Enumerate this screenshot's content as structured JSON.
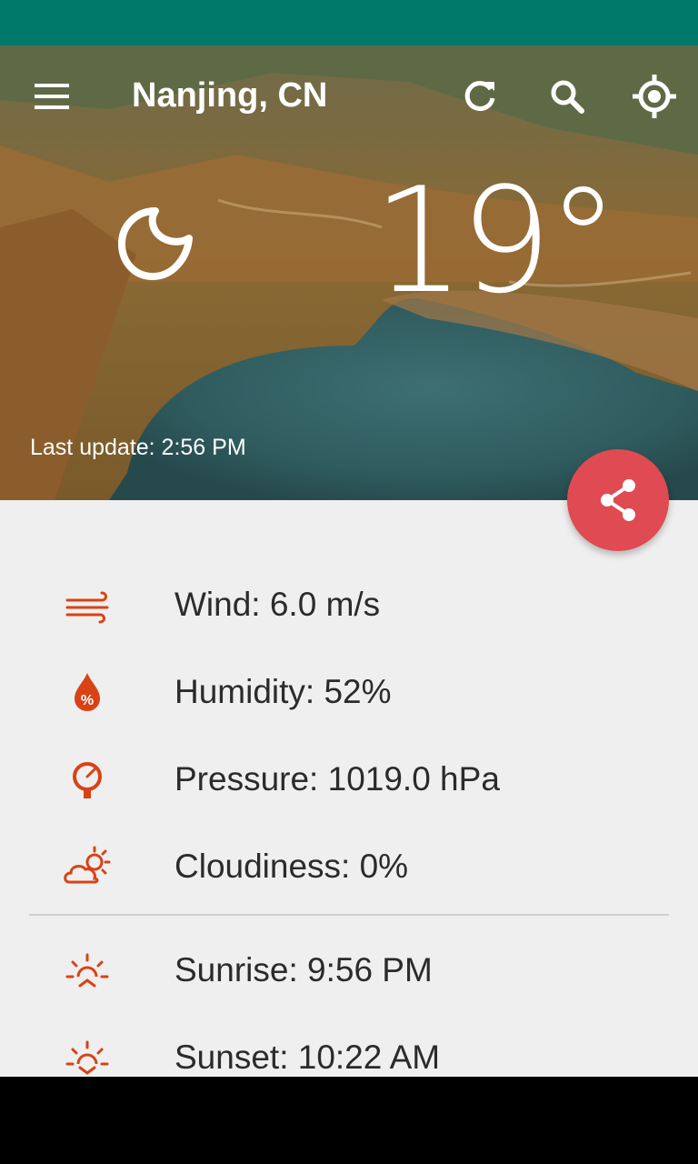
{
  "app": {
    "city": "Nanjing, CN",
    "temperature": "19°",
    "last_update": "Last update: 2:56 PM"
  },
  "toolbar": {
    "menu_icon": "menu-icon",
    "refresh_icon": "refresh-icon",
    "search_icon": "search-icon",
    "location_icon": "my-location-icon"
  },
  "fab": {
    "icon": "share-icon",
    "color": "#e04a52"
  },
  "details": {
    "wind": "Wind: 6.0 m/s",
    "humidity": "Humidity: 52%",
    "pressure": "Pressure: 1019.0 hPa",
    "cloudiness": "Cloudiness: 0%",
    "sunrise": "Sunrise: 9:56 PM",
    "sunset": "Sunset: 10:22 AM"
  },
  "colors": {
    "status_bar": "#00796b",
    "accent_icon": "#d84315",
    "fab": "#e04a52",
    "content_bg": "#efefef"
  }
}
